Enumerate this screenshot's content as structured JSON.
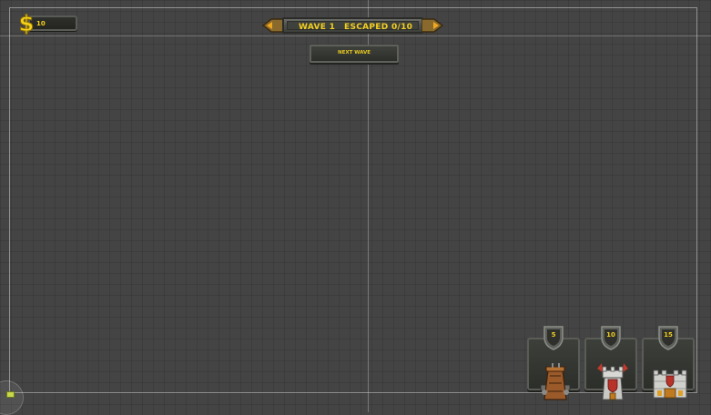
{
  "hud": {
    "money": {
      "icon": "dollar-icon",
      "value": "10"
    },
    "wave": {
      "wave_text": "WAVE 1",
      "escaped_text": "ESCAPED 0/10"
    },
    "next_wave_label": "NEXT WAVE"
  },
  "towers": [
    {
      "cost": "5",
      "icon": "wooden-tower-icon"
    },
    {
      "cost": "10",
      "icon": "stone-tower-icon"
    },
    {
      "cost": "15",
      "icon": "fortress-tower-icon"
    }
  ],
  "colors": {
    "background": "#444444",
    "accent_text": "#f2cf1f",
    "panel": "#2c2e2a",
    "panel_border": "#5a5c56"
  }
}
